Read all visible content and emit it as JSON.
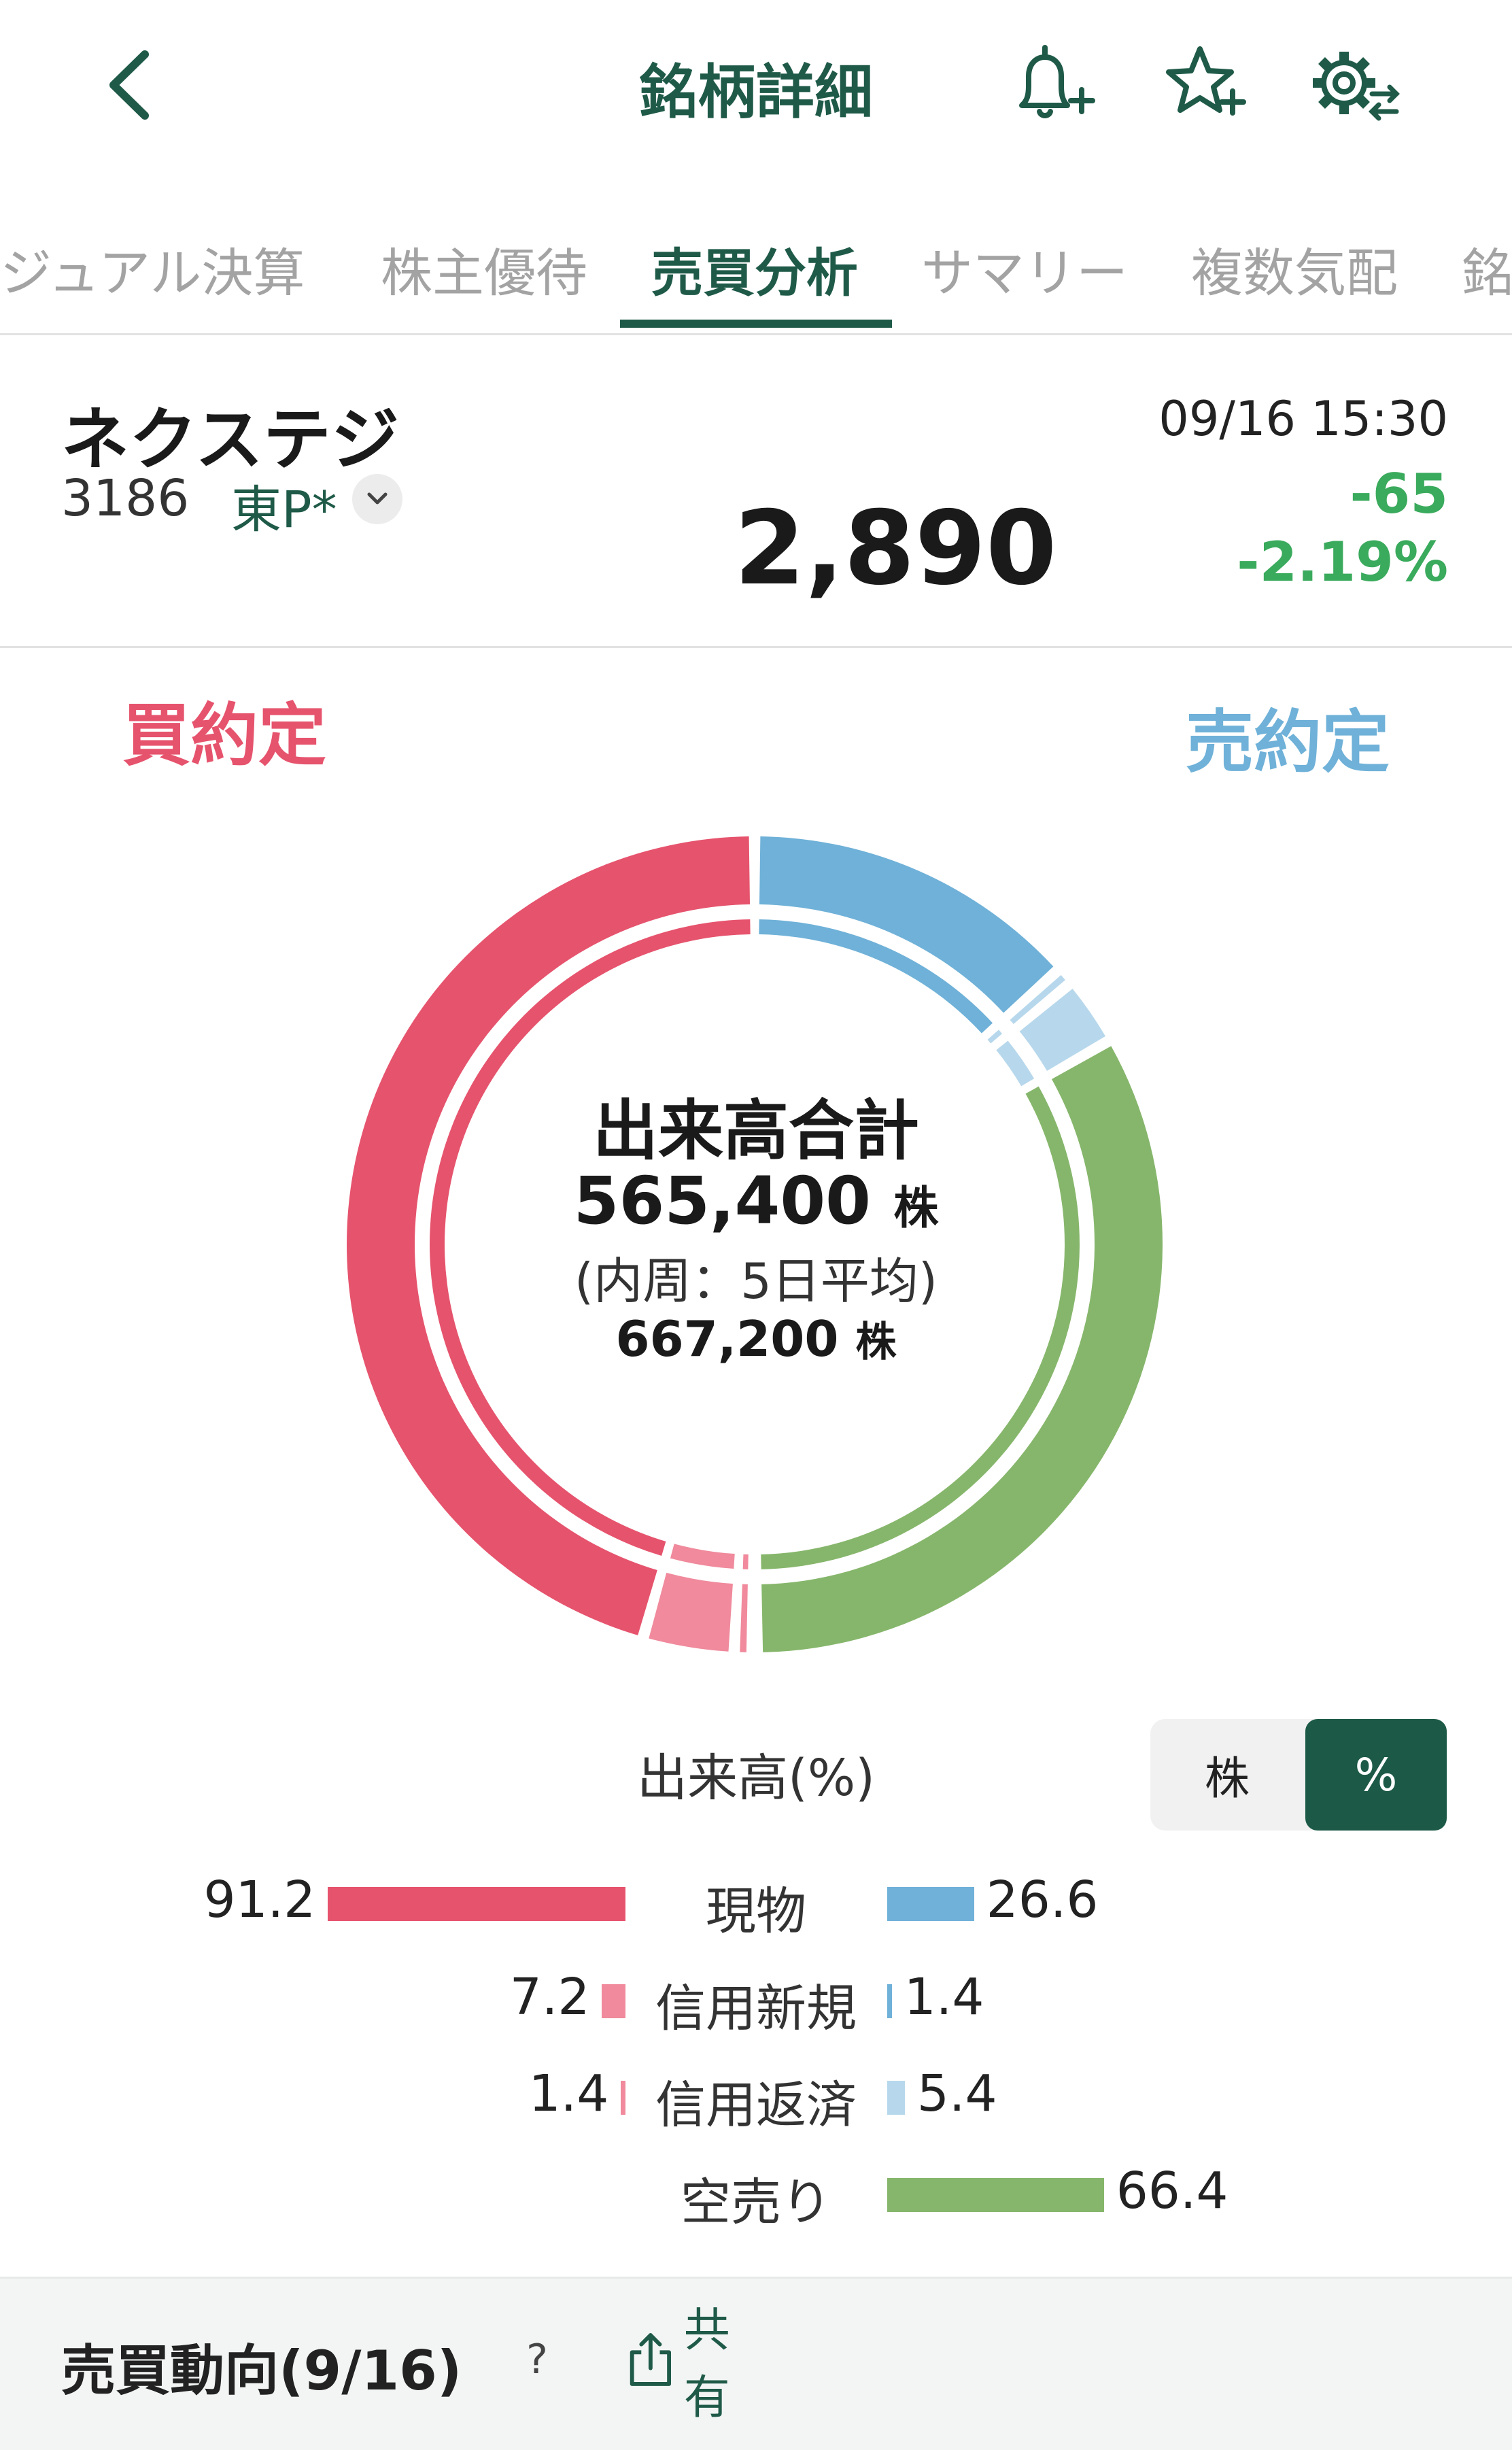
{
  "header": {
    "title": "銘柄詳細"
  },
  "tabs": [
    {
      "label": "ジュアル決算"
    },
    {
      "label": "株主優待"
    },
    {
      "label": "売買分析"
    },
    {
      "label": "サマリー"
    },
    {
      "label": "複数気配"
    },
    {
      "label": "銘"
    }
  ],
  "stock": {
    "name": "ネクステジ",
    "code": "3186",
    "market": "東P*",
    "price": "2,890",
    "datetime": "09/16 15:30",
    "change": "-65",
    "change_pct": "-2.19%"
  },
  "colors": {
    "brand": "#1f5a48",
    "buy": "#e6536d",
    "sell": "#6fb1d8",
    "sell_light": "#b7d8ec",
    "buy_light": "#f08a9c",
    "short": "#86b66b",
    "up_green": "#3aaa5c"
  },
  "analysis": {
    "buy_label": "買約定",
    "sell_label": "売約定",
    "center_title": "出来高合計",
    "center_total": "565,400",
    "center_unit": "株",
    "center_sub": "(内周：5日平均)",
    "center_avg": "667,200",
    "volume_title": "出来高(%)",
    "toggle_share": "株",
    "toggle_percent": "%"
  },
  "chart_data": {
    "type": "bar",
    "categories": [
      "現物",
      "信用新規",
      "信用返済",
      "空売り"
    ],
    "series": [
      {
        "name": "買約定",
        "values": [
          91.2,
          7.2,
          1.4,
          null
        ]
      },
      {
        "name": "売約定",
        "values": [
          26.6,
          1.4,
          5.4,
          66.4
        ]
      }
    ],
    "value_labels": {
      "buy": [
        "91.2",
        "7.2",
        "1.4",
        ""
      ],
      "sell": [
        "26.6",
        "1.4",
        "5.4",
        "66.4"
      ]
    },
    "xlabel": "",
    "ylabel": "出来高(%)",
    "ylim": [
      0,
      100
    ]
  },
  "footer": {
    "title": "売買動向(9/16)",
    "help": "?",
    "share": "共有"
  }
}
